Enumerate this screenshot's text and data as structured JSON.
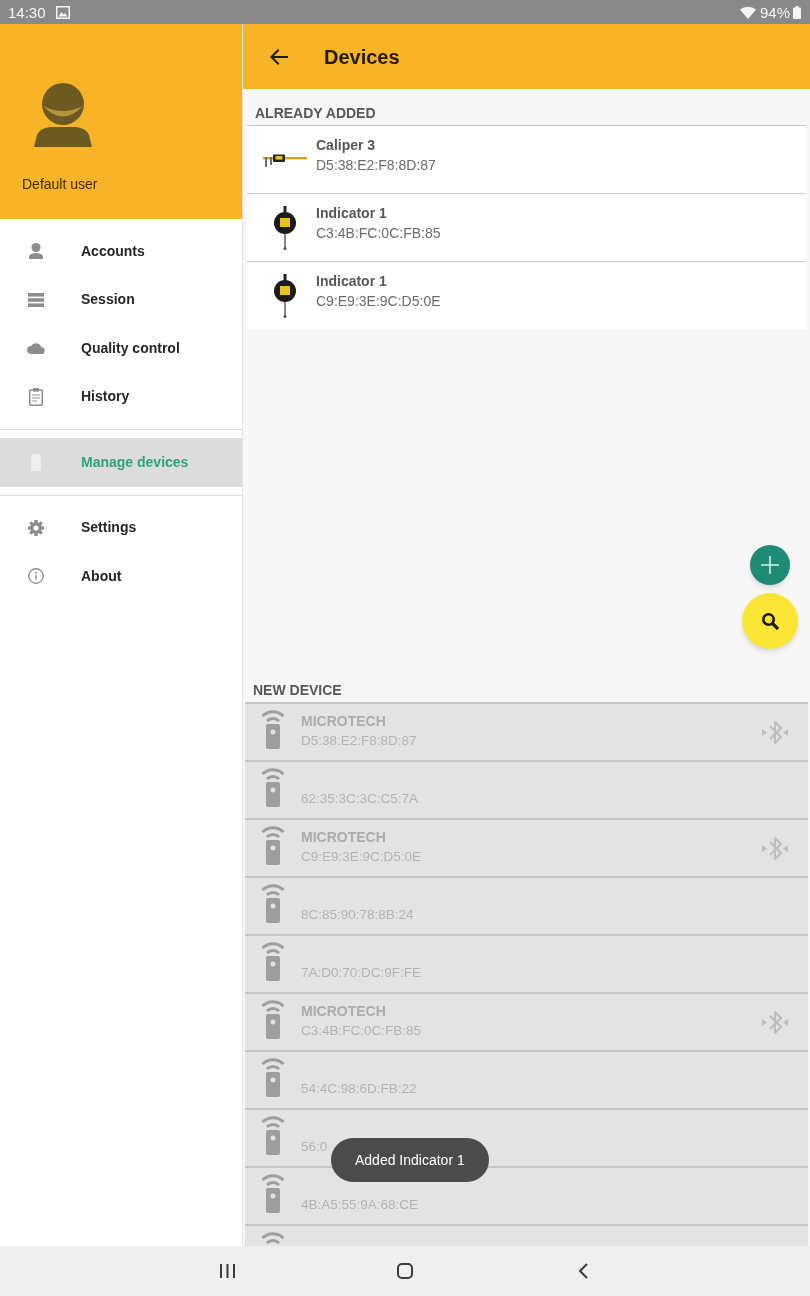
{
  "status_bar": {
    "time": "14:30",
    "battery": "94%"
  },
  "drawer": {
    "user": "Default user",
    "sections": [
      {
        "items": [
          {
            "label": "Accounts",
            "selected": false
          },
          {
            "label": "Session",
            "selected": false
          },
          {
            "label": "Quality control",
            "selected": false
          },
          {
            "label": "History",
            "selected": false
          }
        ]
      },
      {
        "items": [
          {
            "label": "Manage devices",
            "selected": true
          }
        ]
      },
      {
        "items": [
          {
            "label": "Settings",
            "selected": false
          },
          {
            "label": "About",
            "selected": false
          }
        ]
      }
    ]
  },
  "app_bar": {
    "title": "Devices"
  },
  "already_added": {
    "heading": "ALREADY ADDED",
    "devices": [
      {
        "kind": "caliper",
        "name": "Caliper 3",
        "address": "D5:38:E2:F8:8D:87"
      },
      {
        "kind": "indicator",
        "name": "Indicator 1",
        "address": "C3:4B:FC:0C:FB:85"
      },
      {
        "kind": "indicator",
        "name": "Indicator 1",
        "address": "C9:E9:3E:9C:D5:0E"
      }
    ]
  },
  "new_device": {
    "heading": "NEW DEVICE",
    "devices": [
      {
        "name": "MICROTECH",
        "address": "D5:38:E2:F8:8D:87",
        "bluetooth": true,
        "disabled": true
      },
      {
        "address": "62:35:3C:3C:C5:7A",
        "bluetooth": false,
        "disabled": true
      },
      {
        "name": "MICROTECH",
        "address": "C9:E9:3E:9C:D5:0E",
        "bluetooth": true,
        "disabled": true
      },
      {
        "address": "8C:85:90:78:8B:24",
        "bluetooth": false,
        "disabled": true
      },
      {
        "address": "7A:D0:70:DC:9F:FE",
        "bluetooth": false,
        "disabled": true
      },
      {
        "name": "MICROTECH",
        "address": "C3:4B:FC:0C:FB:85",
        "bluetooth": true,
        "disabled": true
      },
      {
        "address": "54:4C:98:6D:FB:22",
        "bluetooth": false,
        "disabled": true
      },
      {
        "address": "56:0",
        "bluetooth": false,
        "disabled": true
      },
      {
        "address": "4B:A5:55:9A:68:CE",
        "bluetooth": false,
        "disabled": true
      }
    ],
    "cut_off_row": true
  },
  "toast": "Added Indicator 1"
}
